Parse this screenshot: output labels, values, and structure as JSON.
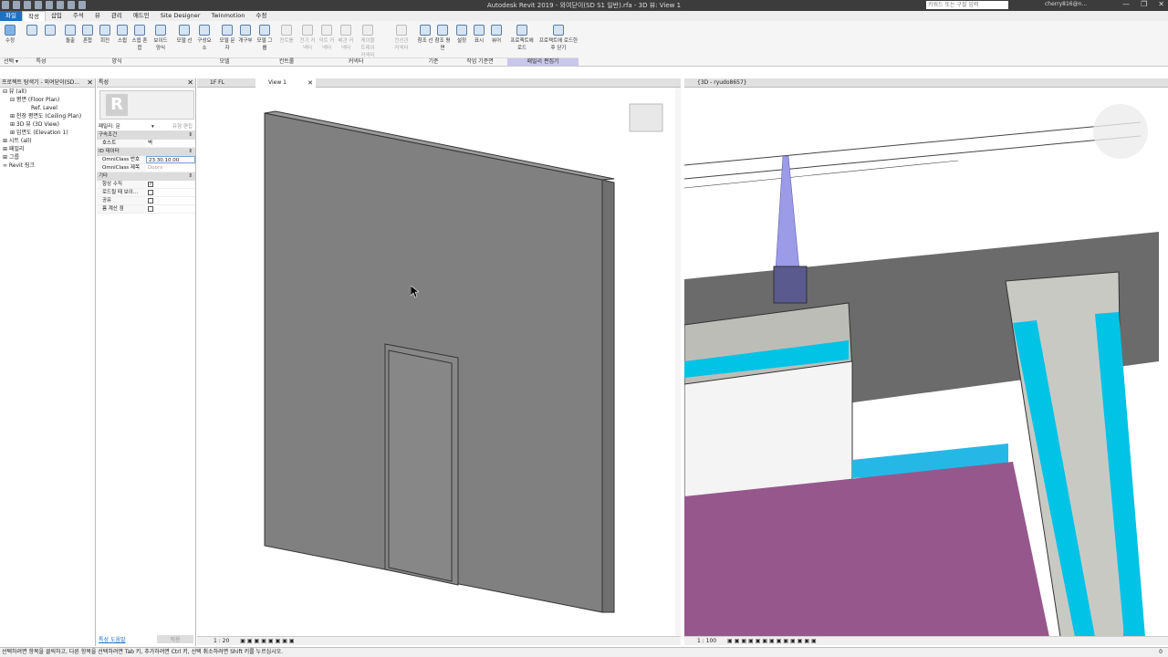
{
  "titlebar": {
    "title": "Autodesk Revit 2019 - 외여닫이(SD S1 일반).rfa - 3D 뷰: View 1",
    "search_placeholder": "키워드 또는 구절 입력",
    "user": "cherry816@n...",
    "window_controls": [
      "—",
      "❐",
      "✕"
    ]
  },
  "menu": {
    "tabs": [
      "파일",
      "작성",
      "삽입",
      "주석",
      "뷰",
      "관리",
      "애드인",
      "Site Designer",
      "Twinmotion",
      "수정"
    ]
  },
  "ribbon": {
    "buttons": [
      {
        "label": "수정"
      },
      {
        "label": ""
      },
      {
        "label": ""
      },
      {
        "label": "돌출"
      },
      {
        "label": "혼합"
      },
      {
        "label": "회전"
      },
      {
        "label": "스윕"
      },
      {
        "label": "스윕 혼합"
      },
      {
        "label": "보이드 양식"
      },
      {
        "label": "모델 선"
      },
      {
        "label": "구성요소"
      },
      {
        "label": "모델 문자"
      },
      {
        "label": "개구부"
      },
      {
        "label": "모델 그룹"
      },
      {
        "label": "컨트롤"
      },
      {
        "label": "전기 커넥터"
      },
      {
        "label": "덕트 커넥터"
      },
      {
        "label": "배관 커넥터"
      },
      {
        "label": "케이블 트레이 커넥터"
      },
      {
        "label": "전선관 커넥터"
      },
      {
        "label": "참조 선"
      },
      {
        "label": "참조 평면"
      },
      {
        "label": "설정"
      },
      {
        "label": "표시"
      },
      {
        "label": "뷰어"
      },
      {
        "label": "프로젝트에 로드"
      },
      {
        "label": "프로젝트에 로드한 후 닫기"
      }
    ],
    "panels": [
      "선택 ▾",
      "특성",
      "양식",
      "모델",
      "컨트롤",
      "커넥터",
      "기준",
      "작업 기준면",
      "패밀리 편집기"
    ]
  },
  "browser": {
    "title": "프로젝트 탐색기 - 외여닫이(SD...",
    "items": [
      {
        "indent": 0,
        "label": "⊟ 뷰 (all)"
      },
      {
        "indent": 1,
        "label": "⊟ 평면 (Floor Plan)"
      },
      {
        "indent": 2,
        "label": "Ref. Level"
      },
      {
        "indent": 1,
        "label": "⊞ 천장 평면도 (Ceiling Plan)"
      },
      {
        "indent": 1,
        "label": "⊞ 3D 뷰 (3D View)"
      },
      {
        "indent": 1,
        "label": "⊞ 입면도 (Elevation 1)"
      },
      {
        "indent": 0,
        "label": "⊞ 시트 (all)"
      },
      {
        "indent": 0,
        "label": "⊞ 패밀리"
      },
      {
        "indent": 0,
        "label": "⊞ 그룹"
      },
      {
        "indent": 0,
        "label": "∞ Revit 링크"
      }
    ]
  },
  "properties": {
    "title": "특성",
    "family_selector": "패밀리: 문",
    "edit_type": "유형 편집",
    "sections": [
      {
        "name": "구속조건",
        "rows": [
          {
            "k": "호스트",
            "v": "벽"
          }
        ]
      },
      {
        "name": "ID 데이터",
        "rows": [
          {
            "k": "OmniClass 번호",
            "v": "23.30.10.00"
          },
          {
            "k": "OmniClass 제목",
            "v": "Doors"
          }
        ]
      },
      {
        "name": "기타",
        "rows": [
          {
            "k": "항상 수직",
            "v": "✓",
            "check": true
          },
          {
            "k": "로드될 때 보이...",
            "v": "",
            "check": true
          },
          {
            "k": "공유",
            "v": "",
            "check": true
          },
          {
            "k": "룸 계산 점",
            "v": "",
            "check": true
          }
        ]
      }
    ],
    "help_link": "특성 도움말",
    "apply": "적용"
  },
  "views": {
    "left_tabs": [
      {
        "label": "1F FL"
      },
      {
        "label": "View 1",
        "active": true
      }
    ],
    "right_tabs": [
      {
        "label": "{3D - ryudo8657}"
      }
    ],
    "left_scale": "1 : 20",
    "right_scale": "1 : 100"
  },
  "status": "선택하려면 항목을 클릭하고, 다른 항목을 선택하려면 Tab 키, 추가하려면 Ctrl 키, 선택 취소하려면 Shift 키를 누르십시오.",
  "status_right": "0"
}
